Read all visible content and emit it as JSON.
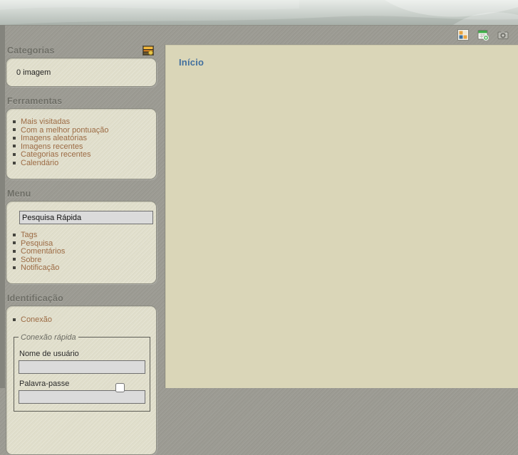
{
  "banner": {
    "name": "gallery-banner"
  },
  "toolbar": {
    "icons": [
      {
        "name": "thumbnails-view-icon"
      },
      {
        "name": "calendar-add-icon"
      },
      {
        "name": "camera-icon"
      }
    ]
  },
  "sidebar": {
    "categories": {
      "heading": "Categorias",
      "icon": "image-feed-icon",
      "summary": "0 imagem"
    },
    "tools": {
      "heading": "Ferramentas",
      "links": [
        "Mais visitadas",
        "Com a melhor pontuação",
        "Imagens aleatórias",
        "Imagens recentes",
        "Categorias recentes",
        "Calendário"
      ]
    },
    "menu": {
      "heading": "Menu",
      "search_value": "Pesquisa Rápida",
      "links": [
        "Tags",
        "Pesquisa",
        "Comentários",
        "Sobre",
        "Notificação"
      ]
    },
    "identification": {
      "heading": "Identificação",
      "connect_link": "Conexão",
      "quick_connect": {
        "legend": "Conexão rápida",
        "username_label": "Nome de usuário",
        "password_label": "Palavra-passe"
      }
    }
  },
  "main": {
    "title": "Início"
  },
  "colors": {
    "page_background": "#9c9b93",
    "panel_background": "#dad6b8",
    "box_background": "#e0decb",
    "link": "#9c6b44",
    "heading": "#6e6e66",
    "title_blue": "#416f9e"
  }
}
